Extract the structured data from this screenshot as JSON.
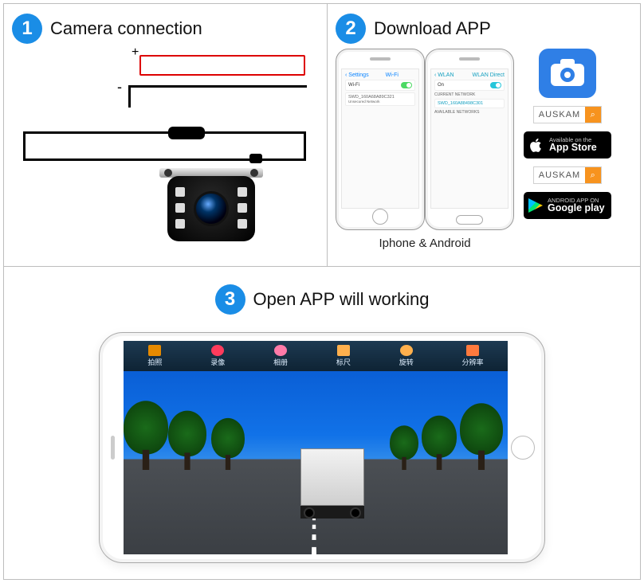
{
  "panel1": {
    "number": "1",
    "title": "Camera connection",
    "plus": "+",
    "minus": "-"
  },
  "panel2": {
    "number": "2",
    "title": "Download APP",
    "caption": "Iphone & Android",
    "iphone": {
      "hdr_left": "‹ Settings",
      "hdr_right": "Wi-Fi",
      "wifi_label": "Wi-Fi",
      "network": "SWD_160A68A89C321",
      "network_sub": "Unsecured Network"
    },
    "android": {
      "hdr_left": "‹  WLAN",
      "hdr_right": "WLAN Direct",
      "on_label": "On",
      "section": "CURRENT NETWORK",
      "network": "SWD_160A88498C301",
      "avail": "AVAILABLE NETWORKS"
    },
    "auskam": "AUSKAM",
    "appstore_small": "Available on the",
    "appstore_large": "App Store",
    "google_small": "ANDROID APP ON",
    "google_large": "Google play"
  },
  "panel3": {
    "number": "3",
    "title": "Open APP will working",
    "tabs": [
      "拍照",
      "录像",
      "相册",
      "标尺",
      "旋转",
      "分辨率"
    ]
  }
}
